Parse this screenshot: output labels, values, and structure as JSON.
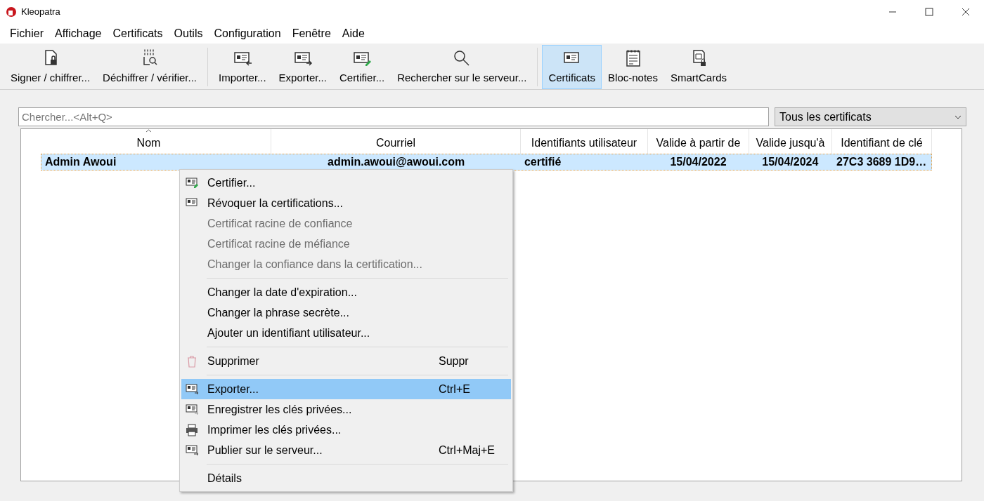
{
  "window": {
    "title": "Kleopatra"
  },
  "menubar": [
    "Fichier",
    "Affichage",
    "Certificats",
    "Outils",
    "Configuration",
    "Fenêtre",
    "Aide"
  ],
  "toolbar": [
    {
      "kind": "button",
      "label": "Signer / chiffrer...",
      "selected": false
    },
    {
      "kind": "button",
      "label": "Déchiffrer / vérifier...",
      "selected": false
    },
    {
      "kind": "separator"
    },
    {
      "kind": "button",
      "label": "Importer...",
      "selected": false
    },
    {
      "kind": "button",
      "label": "Exporter...",
      "selected": false
    },
    {
      "kind": "button",
      "label": "Certifier...",
      "selected": false
    },
    {
      "kind": "button",
      "label": "Rechercher sur le serveur...",
      "selected": false
    },
    {
      "kind": "separator"
    },
    {
      "kind": "button",
      "label": "Certificats",
      "selected": true
    },
    {
      "kind": "button",
      "label": "Bloc-notes",
      "selected": false
    },
    {
      "kind": "button",
      "label": "SmartCards",
      "selected": false
    }
  ],
  "search": {
    "placeholder": "Chercher...<Alt+Q>"
  },
  "filter": {
    "value": "Tous les certificats"
  },
  "table": {
    "columns": [
      "Nom",
      "Courriel",
      "Identifiants utilisateur",
      "Valide à partir de",
      "Valide jusqu'à",
      "Identifiant de clé"
    ],
    "rows": [
      {
        "selected": true,
        "cells": [
          "Admin Awoui",
          "admin.awoui@awoui.com",
          "certifié",
          "15/04/2022",
          "15/04/2024",
          "27C3 3689 1D9…"
        ]
      }
    ]
  },
  "context_menu": [
    {
      "kind": "item",
      "label": "Certifier...",
      "disabled": false,
      "selected": false
    },
    {
      "kind": "item",
      "label": "Révoquer la certifications...",
      "disabled": false,
      "selected": false
    },
    {
      "kind": "item",
      "label": "Certificat racine de confiance",
      "disabled": true,
      "selected": false
    },
    {
      "kind": "item",
      "label": "Certificat racine de méfiance",
      "disabled": true,
      "selected": false
    },
    {
      "kind": "item",
      "label": "Changer la confiance dans la certification...",
      "disabled": true,
      "selected": false
    },
    {
      "kind": "separator"
    },
    {
      "kind": "item",
      "label": "Changer la date d'expiration...",
      "disabled": false,
      "selected": false
    },
    {
      "kind": "item",
      "label": "Changer la phrase secrète...",
      "disabled": false,
      "selected": false
    },
    {
      "kind": "item",
      "label": "Ajouter un identifiant utilisateur...",
      "disabled": false,
      "selected": false
    },
    {
      "kind": "separator"
    },
    {
      "kind": "item",
      "label": "Supprimer",
      "shortcut": "Suppr",
      "disabled": false,
      "selected": false
    },
    {
      "kind": "separator"
    },
    {
      "kind": "item",
      "label": "Exporter...",
      "shortcut": "Ctrl+E",
      "disabled": false,
      "selected": true
    },
    {
      "kind": "item",
      "label": "Enregistrer les clés privées...",
      "disabled": false,
      "selected": false
    },
    {
      "kind": "item",
      "label": "Imprimer les clés privées...",
      "disabled": false,
      "selected": false
    },
    {
      "kind": "item",
      "label": "Publier sur le serveur...",
      "shortcut": "Ctrl+Maj+E",
      "disabled": false,
      "selected": false
    },
    {
      "kind": "separator"
    },
    {
      "kind": "item",
      "label": "Détails",
      "disabled": false,
      "selected": false
    }
  ]
}
